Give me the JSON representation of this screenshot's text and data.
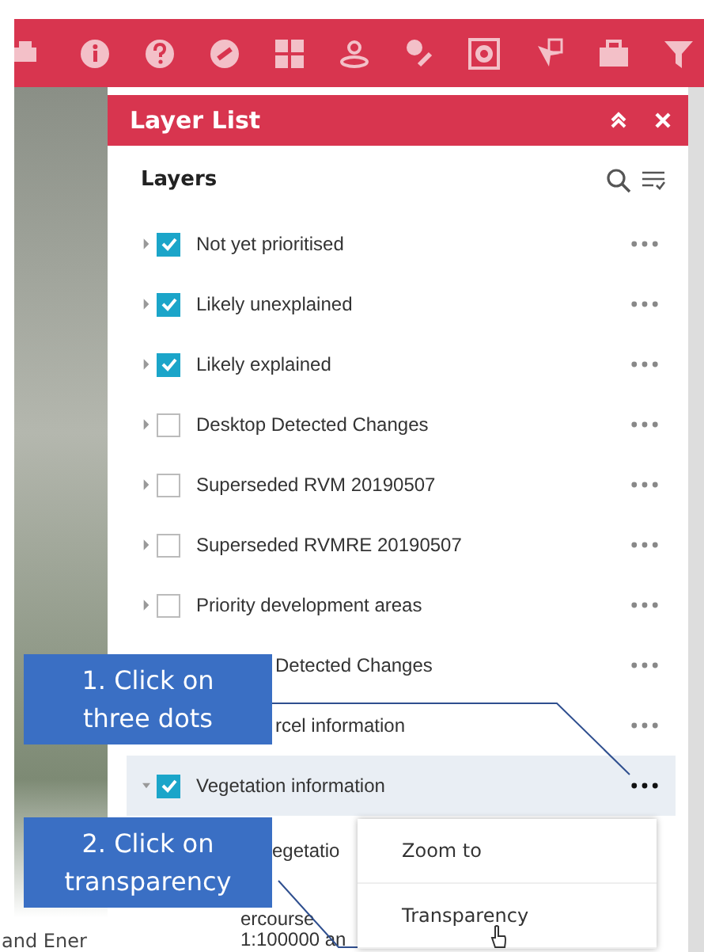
{
  "panel": {
    "title": "Layer List",
    "heading": "Layers",
    "layers": [
      {
        "kind": "layer",
        "label": "Not yet prioritised",
        "checked": true,
        "selected": false
      },
      {
        "kind": "layer",
        "label": "Likely unexplained",
        "checked": true,
        "selected": false
      },
      {
        "kind": "layer",
        "label": "Likely explained",
        "checked": true,
        "selected": false
      },
      {
        "kind": "layer",
        "label": "Desktop Detected Changes",
        "checked": false,
        "selected": false
      },
      {
        "kind": "layer",
        "label": "Superseded RVM 20190507",
        "checked": false,
        "selected": false
      },
      {
        "kind": "layer",
        "label": "Superseded RVMRE 20190507",
        "checked": false,
        "selected": false
      },
      {
        "kind": "layer",
        "label": "Priority development areas",
        "checked": false,
        "selected": false
      },
      {
        "kind": "covered",
        "label": "Detected Changes"
      },
      {
        "kind": "covered",
        "label": "rcel information"
      },
      {
        "kind": "layer",
        "label": "Vegetation information",
        "checked": true,
        "selected": true,
        "expanded": true,
        "children": [
          {
            "label": "egetatio"
          },
          {
            "label": "ercourse\n1:100000 an"
          }
        ]
      }
    ]
  },
  "callouts": [
    {
      "text": "1. Click on\nthree dots"
    },
    {
      "text": "2. Click on\ntransparency"
    }
  ],
  "menu": {
    "items": [
      {
        "label": "Zoom to"
      },
      {
        "label": "Transparency"
      }
    ]
  },
  "map_label": "and Ener"
}
